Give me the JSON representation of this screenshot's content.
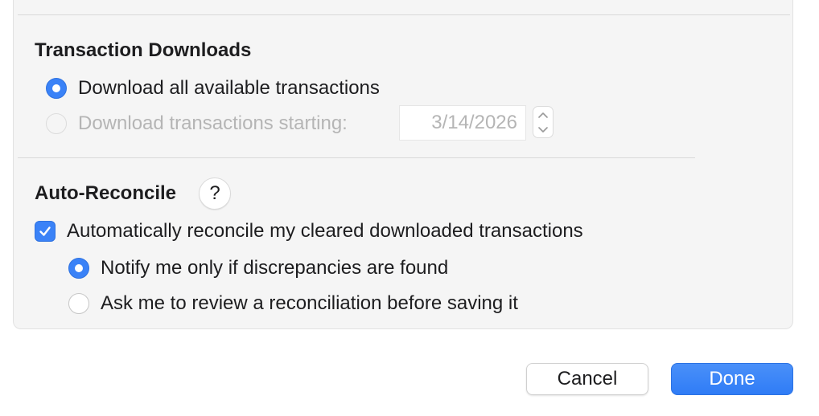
{
  "transaction_downloads": {
    "title": "Transaction Downloads",
    "option_all_label": "Download all available transactions",
    "option_all_selected": true,
    "option_starting_label": "Download transactions starting:",
    "option_starting_selected": false,
    "option_starting_enabled": false,
    "start_date": "3/14/2026"
  },
  "auto_reconcile": {
    "title": "Auto-Reconcile",
    "help_label": "?",
    "auto_checkbox_label": "Automatically reconcile my cleared downloaded transactions",
    "auto_checkbox_checked": true,
    "notify_label": "Notify me only if discrepancies are found",
    "notify_selected": true,
    "ask_label": "Ask me to review a reconciliation before saving it",
    "ask_selected": false
  },
  "footer": {
    "cancel_label": "Cancel",
    "done_label": "Done"
  },
  "colors": {
    "accent": "#3a82f7",
    "panel_background": "#f5f5f5",
    "disabled_text": "#b5b5b5"
  }
}
